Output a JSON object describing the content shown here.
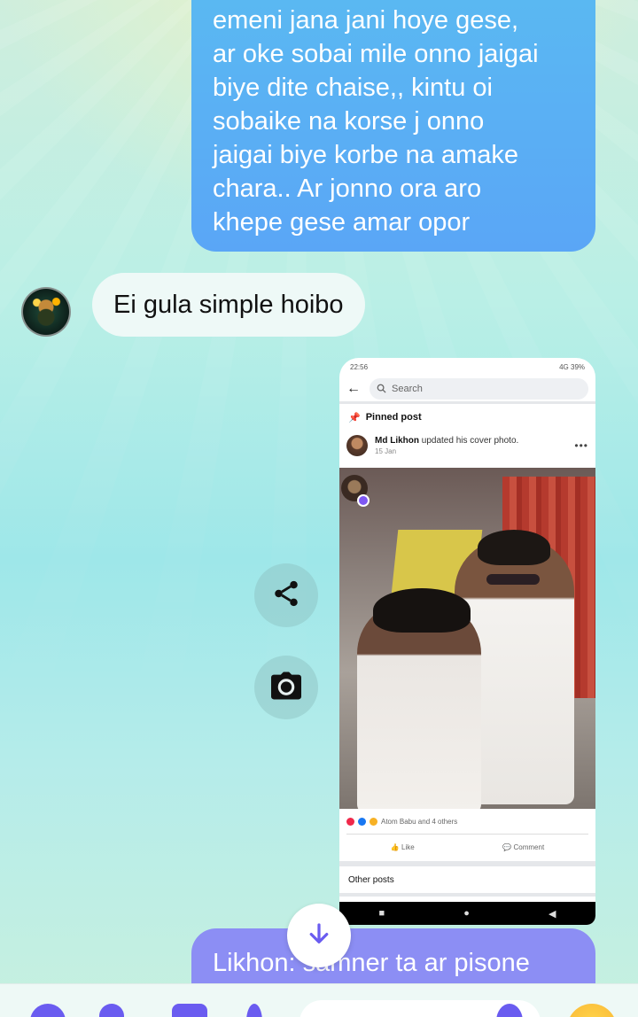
{
  "messages": {
    "outgoing_top": {
      "lines": [
        "emeni jana jani hoye gese,",
        "ar oke sobai mile onno jaigai",
        "biye dite chaise,, kintu oi",
        "sobaike na korse j onno",
        "jaigai biye korbe na amake",
        "chara.. Ar jonno ora aro",
        "khepe gese amar opor"
      ]
    },
    "incoming": {
      "text": "Ei gula simple hoibo"
    },
    "outgoing_bottom": {
      "text": "Likhon: samner ta ar pisone"
    }
  },
  "screenshot": {
    "status_time": "22:56",
    "status_right": "4G 39%",
    "search_placeholder": "Search",
    "pinned_label": "Pinned post",
    "poster_name": "Md Likhon",
    "poster_action": "updated his cover photo.",
    "poster_date": "15 Jan",
    "reactions_text": "Atom Babu and 4 others",
    "like_label": "Like",
    "comment_label": "Comment",
    "other_posts_label": "Other posts"
  },
  "icons": {
    "share": "share-icon",
    "camera": "camera-icon",
    "scroll_down": "arrow-down-icon"
  },
  "colors": {
    "outgoing_bubble": "#5aa6f6",
    "outgoing_bubble_bottom": "#8c8ef4",
    "incoming_bubble": "#eef9f7"
  }
}
